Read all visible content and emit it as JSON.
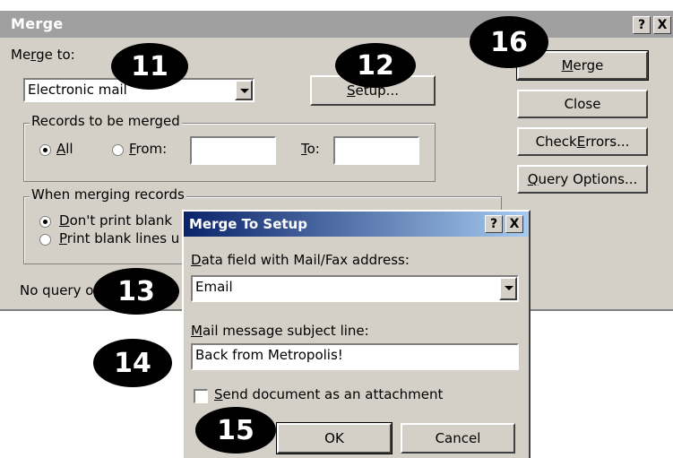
{
  "merge": {
    "title": "Merge",
    "help_glyph": "?",
    "close_glyph": "X",
    "merge_to": {
      "label_pre": "Me",
      "label_ul": "r",
      "label_post": "ge to:",
      "value": "Electronic mail"
    },
    "setup_button": {
      "ul": "S",
      "rest": "etup..."
    },
    "records_group": {
      "label": "Records to be merged",
      "all": {
        "ul": "A",
        "rest": "ll"
      },
      "from": {
        "ul": "F",
        "rest": "rom:"
      },
      "from_value": "",
      "to": {
        "ul": "T",
        "rest": "o:"
      },
      "to_value": ""
    },
    "when_group": {
      "label": "When merging records",
      "option1": {
        "ul": "D",
        "rest": "on't print blank"
      },
      "option2": {
        "ul": "P",
        "rest": "rint blank lines u"
      }
    },
    "status": "No query op",
    "buttons": {
      "merge": {
        "pre": "",
        "ul": "M",
        "rest": "erge"
      },
      "close": "Close",
      "check_errors": {
        "pre": "Check ",
        "ul": "E",
        "rest": "rrors..."
      },
      "query_options": {
        "pre": "",
        "ul": "Q",
        "rest": "uery Options..."
      }
    }
  },
  "setup": {
    "title": "Merge To Setup",
    "help_glyph": "?",
    "close_glyph": "X",
    "data_field": {
      "ul": "D",
      "rest": "ata field with Mail/Fax address:",
      "value": "Email"
    },
    "subject": {
      "ul": "M",
      "rest": "ail message subject line:",
      "value": "Back from Metropolis!"
    },
    "attachment": {
      "ul": "S",
      "rest": "end document as an attachment",
      "checked": false
    },
    "ok_label": "OK",
    "cancel_label": "Cancel"
  },
  "callouts": [
    "11",
    "12",
    "13",
    "14",
    "15",
    "16"
  ]
}
